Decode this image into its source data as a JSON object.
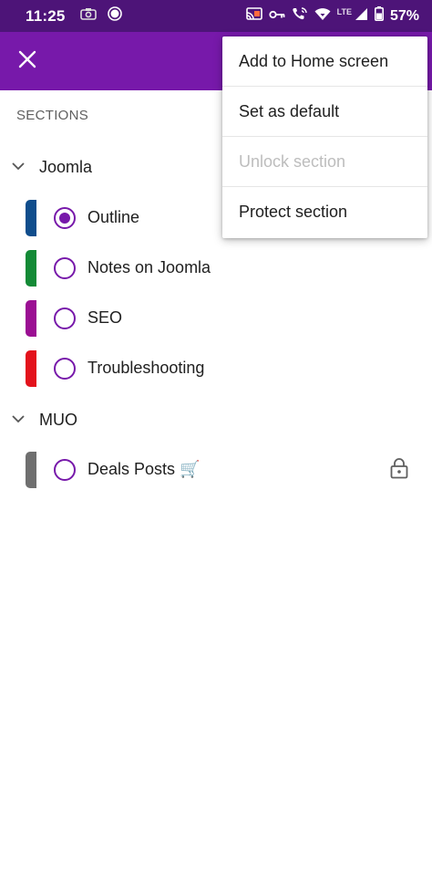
{
  "status_bar": {
    "time": "11:25",
    "network_label": "LTE",
    "battery_percent": "57%",
    "icons": [
      "camera-icon",
      "record-icon",
      "cast-icon",
      "vpn-key-icon",
      "wifi-calling-icon",
      "wifi-icon",
      "signal-icon",
      "battery-icon"
    ]
  },
  "app_bar": {
    "color": "#7719aa",
    "close_icon": "close-icon"
  },
  "sections": {
    "heading": "SECTIONS",
    "groups": [
      {
        "name": "Joomla",
        "items": [
          {
            "label": "Outline",
            "color": "#0f4d8c",
            "selected": true
          },
          {
            "label": "Notes on Joomla",
            "color": "#138a36",
            "selected": false
          },
          {
            "label": "SEO",
            "color": "#9b0f93",
            "selected": false
          },
          {
            "label": "Troubleshooting",
            "color": "#e3121c",
            "selected": false
          }
        ]
      },
      {
        "name": "MUO",
        "items": [
          {
            "label": "Deals Posts 🛒",
            "color": "#6f6f6f",
            "selected": false,
            "locked": true
          }
        ]
      }
    ]
  },
  "menu": {
    "items": [
      {
        "label": "Add to Home screen",
        "enabled": true
      },
      {
        "label": "Set as default",
        "enabled": true
      },
      {
        "label": "Unlock section",
        "enabled": false
      },
      {
        "label": "Protect section",
        "enabled": true
      }
    ]
  }
}
